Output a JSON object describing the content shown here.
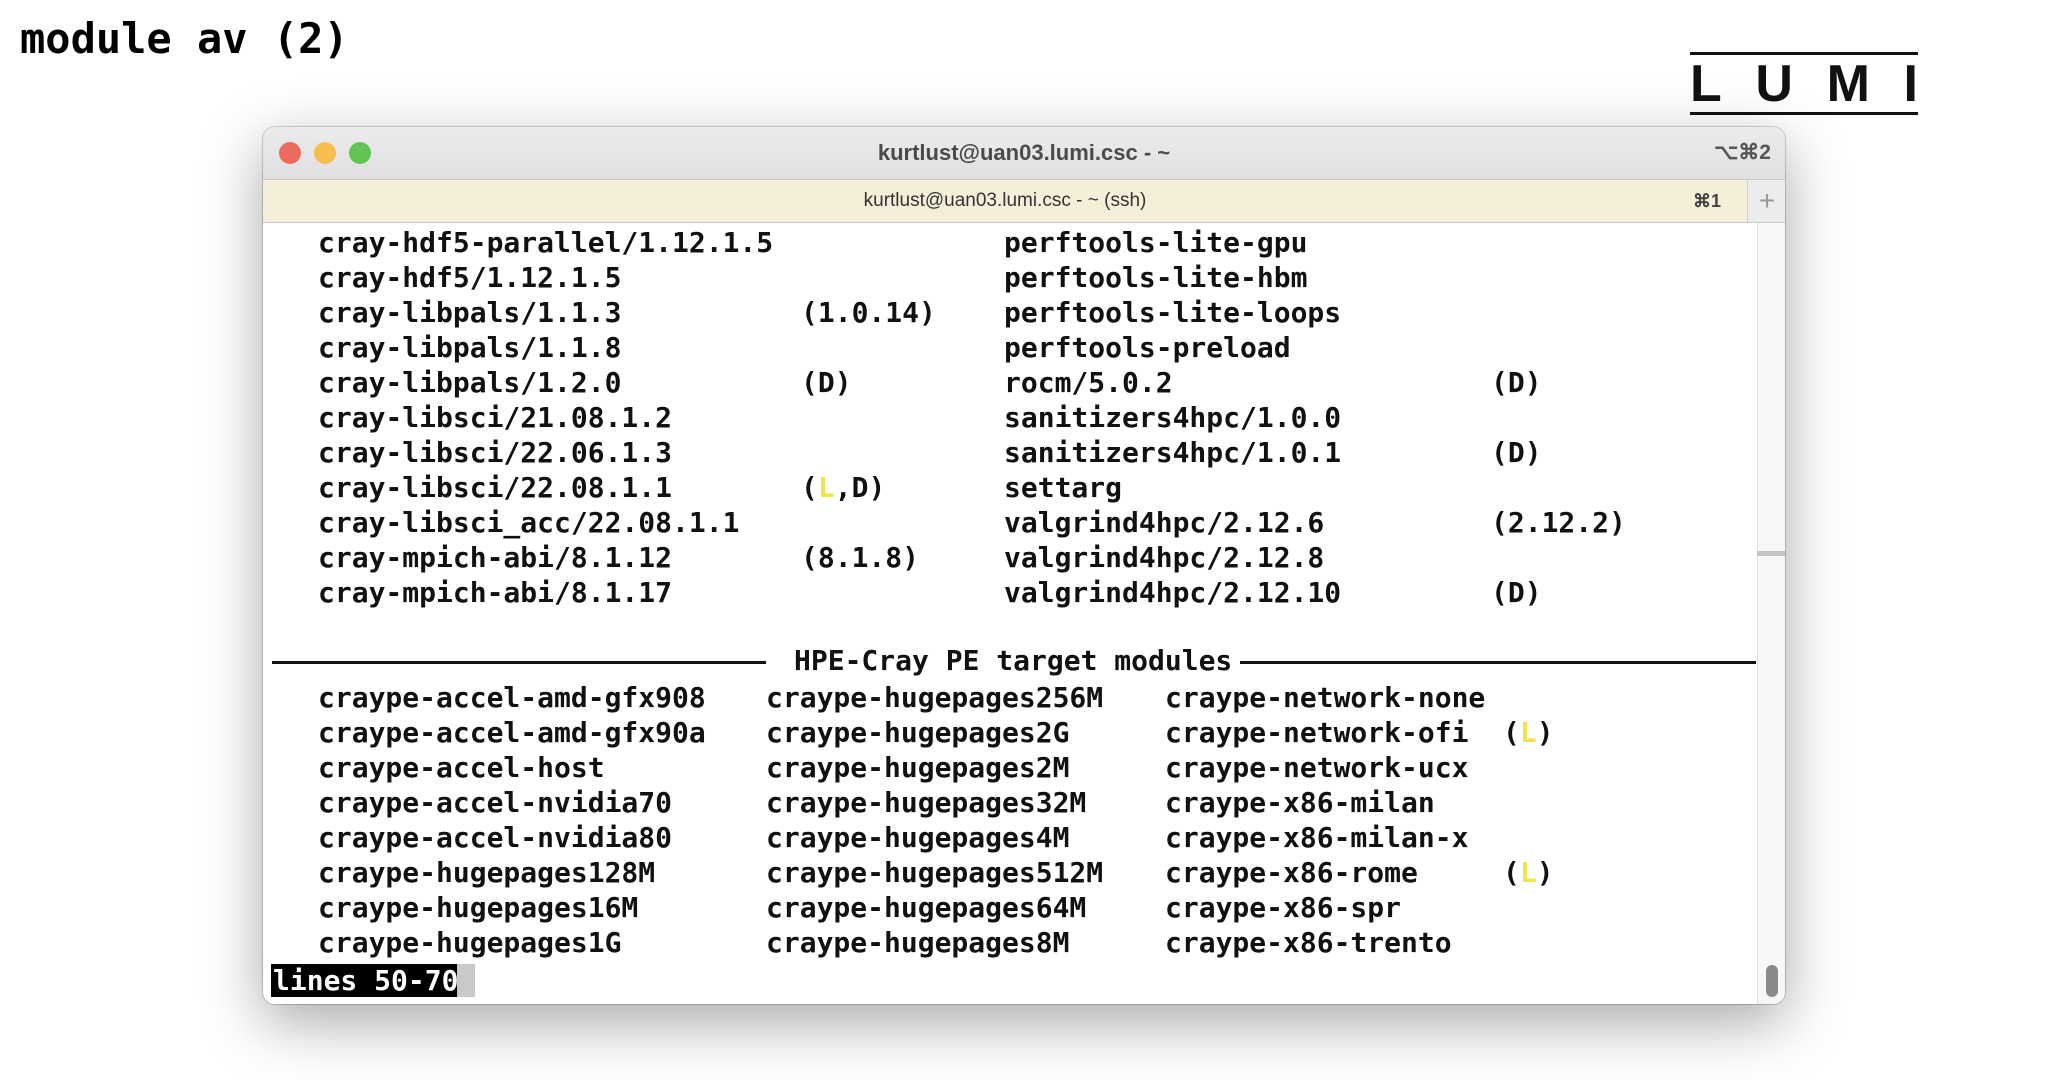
{
  "slide": {
    "title": "module av (2)",
    "logo_letters": [
      "L",
      "U",
      "M",
      "I"
    ]
  },
  "window": {
    "title": "kurtlust@uan03.lumi.csc - ~",
    "shortcut": "⌥⌘2",
    "tab_label": "kurtlust@uan03.lumi.csc - ~ (ssh)",
    "tab_shortcut": "⌘1",
    "new_tab_symbol": "+",
    "traffic_colors": {
      "close": "#ed6a5e",
      "minimize": "#f5bf4f",
      "zoom": "#61c554"
    }
  },
  "terminal": {
    "upper_rows": [
      {
        "c1": "cray-hdf5-parallel/1.12.1.5",
        "c2": "",
        "c3": "perftools-lite-gpu",
        "c4": ""
      },
      {
        "c1": "cray-hdf5/1.12.1.5",
        "c2": "",
        "c3": "perftools-lite-hbm",
        "c4": ""
      },
      {
        "c1": "cray-libpals/1.1.3",
        "c2": "(1.0.14)",
        "c3": "perftools-lite-loops",
        "c4": ""
      },
      {
        "c1": "cray-libpals/1.1.8",
        "c2": "",
        "c3": "perftools-preload",
        "c4": ""
      },
      {
        "c1": "cray-libpals/1.2.0",
        "c2": "(D)",
        "c3": "rocm/5.0.2",
        "c4": "(D)"
      },
      {
        "c1": "cray-libsci/21.08.1.2",
        "c2": "",
        "c3": "sanitizers4hpc/1.0.0",
        "c4": ""
      },
      {
        "c1": "cray-libsci/22.06.1.3",
        "c2": "",
        "c3": "sanitizers4hpc/1.0.1",
        "c4": "(D)"
      },
      {
        "c1": "cray-libsci/22.08.1.1",
        "c2": "(L,D)",
        "c3": "settarg",
        "c4": ""
      },
      {
        "c1": "cray-libsci_acc/22.08.1.1",
        "c2": "",
        "c3": "valgrind4hpc/2.12.6",
        "c4": "(2.12.2)"
      },
      {
        "c1": "cray-mpich-abi/8.1.12",
        "c2": "(8.1.8)",
        "c3": "valgrind4hpc/2.12.8",
        "c4": ""
      },
      {
        "c1": "cray-mpich-abi/8.1.17",
        "c2": "",
        "c3": "valgrind4hpc/2.12.10",
        "c4": "(D)"
      }
    ],
    "section_title": "HPE-Cray PE target modules",
    "lower_rows": [
      {
        "c1": "craype-accel-amd-gfx908",
        "c2": "craype-hugepages256M",
        "c3": "craype-network-none",
        "c4": ""
      },
      {
        "c1": "craype-accel-amd-gfx90a",
        "c2": "craype-hugepages2G",
        "c3": "craype-network-ofi",
        "c4": "(L)"
      },
      {
        "c1": "craype-accel-host",
        "c2": "craype-hugepages2M",
        "c3": "craype-network-ucx",
        "c4": ""
      },
      {
        "c1": "craype-accel-nvidia70",
        "c2": "craype-hugepages32M",
        "c3": "craype-x86-milan",
        "c4": ""
      },
      {
        "c1": "craype-accel-nvidia80",
        "c2": "craype-hugepages4M",
        "c3": "craype-x86-milan-x",
        "c4": ""
      },
      {
        "c1": "craype-hugepages128M",
        "c2": "craype-hugepages512M",
        "c3": "craype-x86-rome",
        "c4": "(L)"
      },
      {
        "c1": "craype-hugepages16M",
        "c2": "craype-hugepages64M",
        "c3": "craype-x86-spr",
        "c4": ""
      },
      {
        "c1": "craype-hugepages1G",
        "c2": "craype-hugepages8M",
        "c3": "craype-x86-trento",
        "c4": ""
      }
    ],
    "pager_status": "lines 50-70",
    "loaded_marker_color": "#f2e24e"
  }
}
